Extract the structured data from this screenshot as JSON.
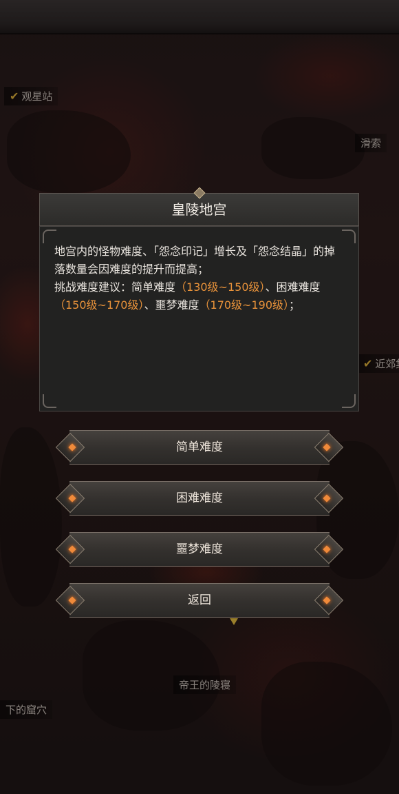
{
  "map_locations": {
    "guanxingzhan": "观星站",
    "right_top": "滑索",
    "right_mid": "近郊集",
    "bottom_center": "帝王的陵寝",
    "bottom_left": "下的窟穴"
  },
  "dialog": {
    "title": "皇陵地宫",
    "line1": "地宫内的怪物难度、「怨念印记」增长及「怨念结晶」的掉落数量会因难度的提升而提高；",
    "line2_prefix": "挑战难度建议：简单难度",
    "easy_range": "（130级~150级）",
    "sep1": "、困难难度",
    "hard_range": "（150级~170级）",
    "sep2": "、噩梦难度",
    "nightmare_range": "（170级~190级）",
    "end": "；"
  },
  "buttons": {
    "easy": "简单难度",
    "hard": "困难难度",
    "nightmare": "噩梦难度",
    "back": "返回"
  },
  "colors": {
    "highlight": "#e8923a",
    "check": "#e0b23a"
  }
}
